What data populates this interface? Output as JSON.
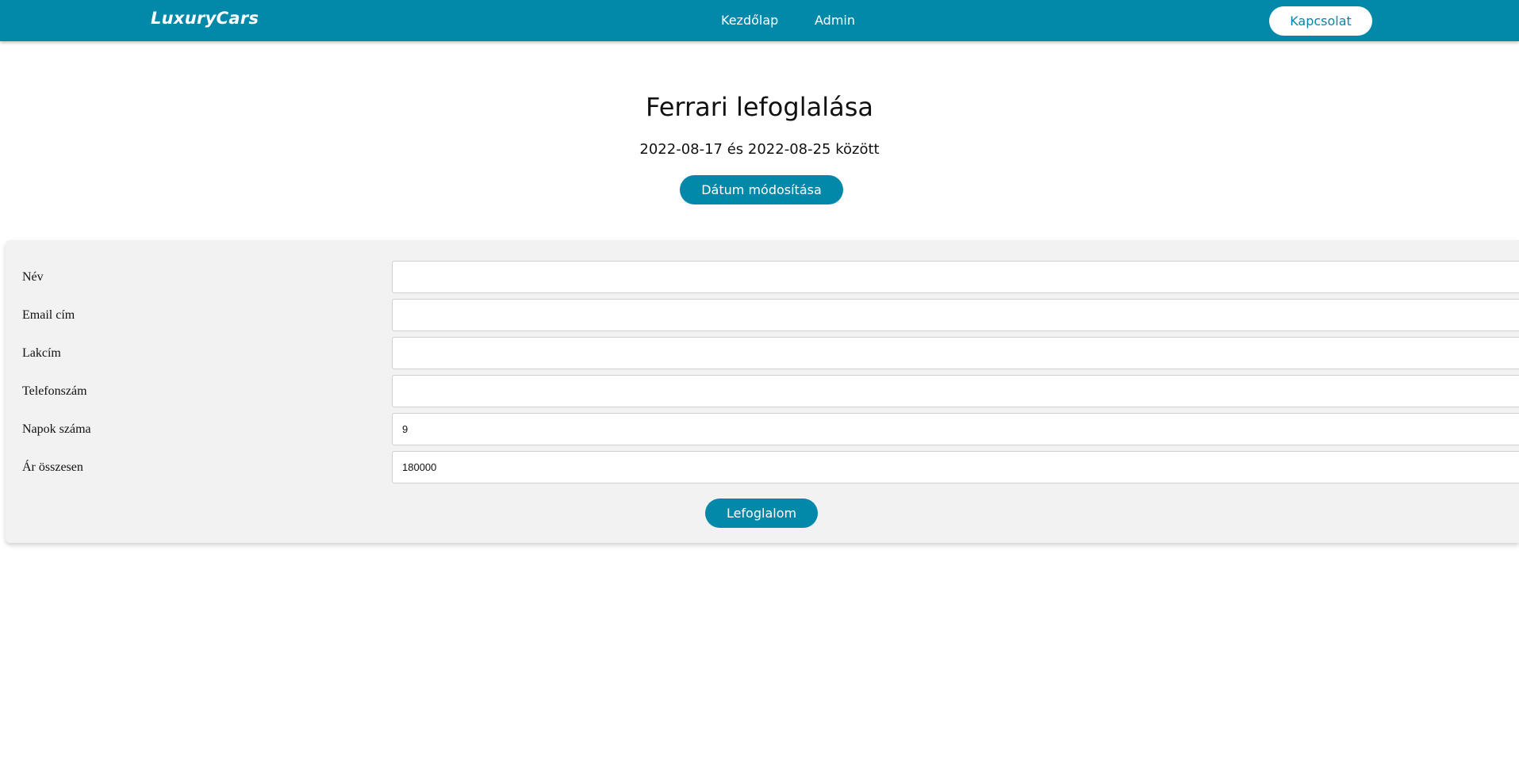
{
  "header": {
    "logo": "LuxuryCars",
    "nav": [
      {
        "label": "Kezdőlap"
      },
      {
        "label": "Admin"
      }
    ],
    "contact_label": "Kapcsolat"
  },
  "main": {
    "title": "Ferrari lefoglalása",
    "date_range": "2022-08-17 és 2022-08-25 között",
    "change_date_label": "Dátum módosítása"
  },
  "form": {
    "fields": [
      {
        "label": "Név",
        "value": ""
      },
      {
        "label": "Email cím",
        "value": ""
      },
      {
        "label": "Lakcím",
        "value": ""
      },
      {
        "label": "Telefonszám",
        "value": ""
      },
      {
        "label": "Napok száma",
        "value": "9"
      },
      {
        "label": "Ár összesen",
        "value": "180000"
      }
    ],
    "submit_label": "Lefoglalom"
  },
  "colors": {
    "brand": "#0288a8",
    "form_background": "#f2f2f2"
  }
}
